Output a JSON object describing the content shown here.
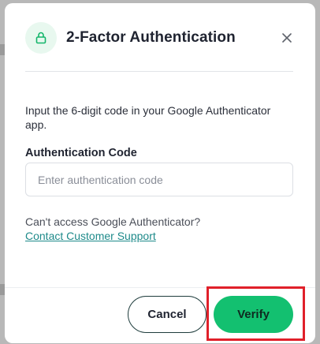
{
  "dialog": {
    "title": "2-Factor Authentication",
    "instructions": "Input the 6-digit code in your Google Authenticator app.",
    "field_label": "Authentication Code",
    "input": {
      "placeholder": "Enter authentication code",
      "value": ""
    },
    "help_text": "Can't access Google Authenticator?",
    "support_link": "Contact Customer Support",
    "buttons": {
      "cancel": "Cancel",
      "verify": "Verify"
    },
    "icons": {
      "header": "lock-icon",
      "close": "close-icon"
    },
    "colors": {
      "accent": "#13c070",
      "link": "#1e8a8a",
      "highlight": "#e0202a"
    }
  }
}
